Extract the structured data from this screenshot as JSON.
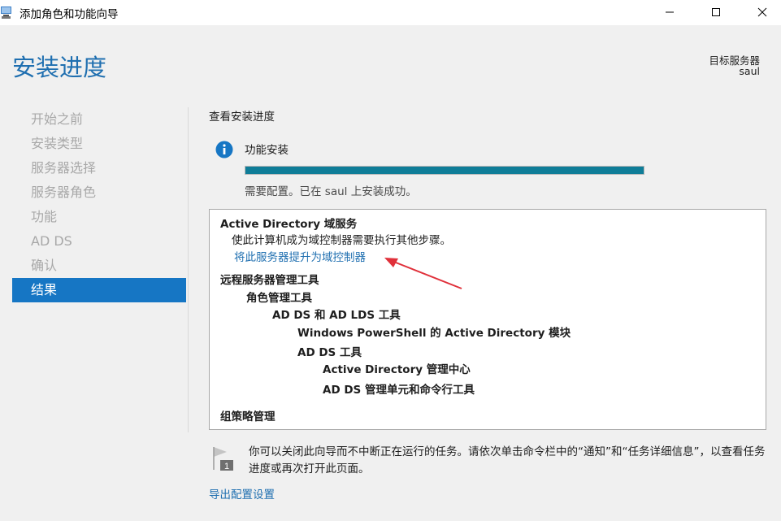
{
  "window": {
    "title": "添加角色和功能向导"
  },
  "page": {
    "title": "安装进度"
  },
  "target_server": {
    "label": "目标服务器",
    "name": "saul"
  },
  "nav": {
    "items": [
      {
        "label": "开始之前"
      },
      {
        "label": "安装类型"
      },
      {
        "label": "服务器选择"
      },
      {
        "label": "服务器角色"
      },
      {
        "label": "功能"
      },
      {
        "label": "AD DS"
      },
      {
        "label": "确认"
      },
      {
        "label": "结果"
      }
    ],
    "active_index": 7
  },
  "progress": {
    "heading": "查看安装进度",
    "feature_title": "功能安装",
    "fraction": 1.0,
    "status": "需要配置。已在 saul 上安装成功。"
  },
  "results": {
    "ad_ds_title": "Active Directory 域服务",
    "ad_ds_desc": "使此计算机成为域控制器需要执行其他步骤。",
    "promote_link": "将此服务器提升为域控制器",
    "rsat": "远程服务器管理工具",
    "role_tools": "角色管理工具",
    "adds_lds_tools": "AD DS 和 AD LDS 工具",
    "ps_module": "Windows PowerShell 的 Active Directory 模块",
    "adds_tools": "AD DS 工具",
    "ad_admin_center": "Active Directory 管理中心",
    "adds_snapins": "AD DS 管理单元和命令行工具",
    "gpm": "组策略管理"
  },
  "notice": {
    "text": "你可以关闭此向导而不中断正在运行的任务。请依次单击命令栏中的“通知”和“任务详细信息”，以查看任务进度或再次打开此页面。"
  },
  "footer": {
    "export_link": "导出配置设置"
  },
  "colors": {
    "accent": "#1676c4",
    "progress": "#0f7d98",
    "arrow": "#e0303a",
    "link": "#1f6fb0"
  }
}
